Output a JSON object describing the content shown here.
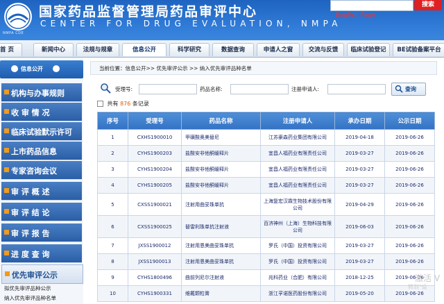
{
  "header": {
    "logo_caption": "NMPA CDE",
    "title": "国家药品监督管理局药品审评中心",
    "subtitle": "CENTER FOR DRUG EVALUATION, NMPA",
    "search_button": "搜索",
    "english_link": "English Page",
    "search_placeholder": ""
  },
  "nav": {
    "items": [
      "首 页",
      "新闻中心",
      "法规与规章",
      "信息公开",
      "科学研究",
      "数据查询",
      "申请人之窗",
      "交流与反馈",
      "临床试验登记",
      "BE试验备案平台"
    ],
    "active_index": 3
  },
  "sidebar": {
    "header": "信息公开",
    "items": [
      {
        "label": "机构与办事规则"
      },
      {
        "label": "收 审 情 况"
      },
      {
        "label": "临床试验默示许可"
      },
      {
        "label": "上市药品信息"
      },
      {
        "label": "专家咨询会议"
      },
      {
        "label": "审 评 概 述"
      },
      {
        "label": "审 评 结 论"
      },
      {
        "label": "审 评 报 告"
      },
      {
        "label": "进 度 查 询"
      },
      {
        "label": "优先审评公示"
      }
    ],
    "sub_items": [
      "拟优先审评品种公示",
      "纳入优先审评品种名单"
    ]
  },
  "breadcrumb": "当前位置：信息公开>> 优先审评公示 >> 纳入优先审评品种名单",
  "filter": {
    "accept_no_label": "受理号:",
    "drug_name_label": "药品名称:",
    "applicant_label": "注册申请人:",
    "query_button": "查询"
  },
  "count": {
    "prefix": "共有",
    "total": "876",
    "suffix": "条记录"
  },
  "table": {
    "headers": [
      "序号",
      "受理号",
      "药品名称",
      "注册申请人",
      "承办日期",
      "公示日期"
    ],
    "rows": [
      [
        "1",
        "CXHS1900010",
        "甲磺酸奥美替尼",
        "江苏豪森药业集团有限公司",
        "2019-04-18",
        "2019-06-26"
      ],
      [
        "2",
        "CYHS1900203",
        "盐酸安非他酮缓释片",
        "宜昌人福药业有限责任公司",
        "2019-03-27",
        "2019-06-26"
      ],
      [
        "3",
        "CYHS1900204",
        "盐酸安非他酮缓释片",
        "宜昌人福药业有限责任公司",
        "2019-03-27",
        "2019-06-26"
      ],
      [
        "4",
        "CYHS1900205",
        "盐酸安非他酮缓释片",
        "宜昌人福药业有限责任公司",
        "2019-03-27",
        "2019-06-26"
      ],
      [
        "5",
        "CXSS1900021",
        "注射用曲妥珠单抗",
        "上海复宏汉霖生物技术股份有限公司",
        "2019-04-29",
        "2019-06-26"
      ],
      [
        "6",
        "CXSS1900025",
        "替雷利珠单抗注射液",
        "百济神州（上海）生物科技有限公司",
        "2019-06-03",
        "2019-06-26"
      ],
      [
        "7",
        "JXSS1900012",
        "注射用恩美曲妥珠单抗",
        "罗氏（中国）投资有限公司",
        "2019-03-27",
        "2019-06-26"
      ],
      [
        "8",
        "JXSS1900013",
        "注射用恩美曲妥珠单抗",
        "罗氏（中国）投资有限公司",
        "2019-03-27",
        "2019-06-26"
      ],
      [
        "9",
        "CYHS1800496",
        "曲前列尼尔注射液",
        "兆科药业（合肥）有限公司",
        "2018-12-25",
        "2019-06-26"
      ],
      [
        "10",
        "CYHS1900331",
        "维戴颗粒膏",
        "浙江孚诺医药股份有限公司",
        "2019-05-20",
        "2019-06-26"
      ]
    ]
  },
  "watermark": {
    "line1": "激活 V",
    "line2": "转到\"设"
  },
  "colors": {
    "header_blue": "#2f7ad6",
    "accent_orange": "#f29a1b",
    "count_orange": "#e05a00",
    "search_red": "#e02020"
  }
}
